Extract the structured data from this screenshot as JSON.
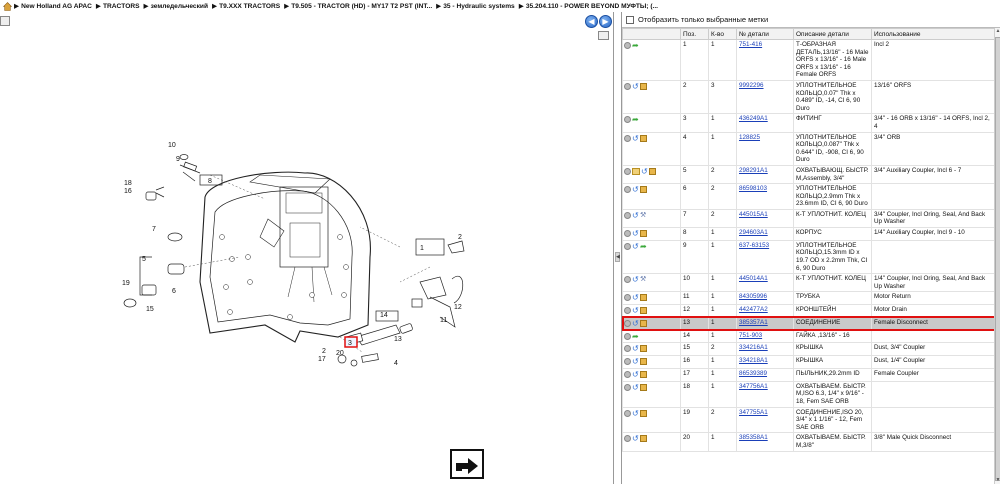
{
  "breadcrumb": [
    "New Holland AG APAC",
    "TRACTORS",
    "земледельческий",
    "T9.XXX TRACTORS",
    "T9.505 - TRACTOR (HD) - MY17 T2 PST (INT...",
    "35 - Hydraulic systems",
    "35.204.110 - POWER BEYOND МУФТЫ; (..."
  ],
  "filter_label": "Отобразить только выбранные метки",
  "columns": [
    "",
    "Поз.",
    "К-во",
    "№ детали",
    "Описание детали",
    "Использование"
  ],
  "diagram_labels": [
    "10",
    "9",
    "8",
    "18",
    "16",
    "7",
    "5",
    "6",
    "19",
    "15",
    "1",
    "2",
    "11",
    "12",
    "14",
    "3",
    "13",
    "2",
    "4",
    "17",
    "20"
  ],
  "rows": [
    {
      "icons": [
        "info",
        "green"
      ],
      "pos": "1",
      "qty": "1",
      "part": "751-416",
      "desc": "Т-ОБРАЗНАЯ ДЕТАЛЬ,13/16\" - 16 Male ORFS x 13/16\" - 16 Male ORFS x 13/16\" - 16 Female ORFS",
      "usage": "Incl 2"
    },
    {
      "icons": [
        "info",
        "blue",
        "box"
      ],
      "pos": "2",
      "qty": "3",
      "part": "9992296",
      "desc": "УПЛОТНИТЕЛЬНОЕ КОЛЬЦО,0.07\" Thk x 0.489\" ID, -14, CI 6, 90 Duro",
      "usage": "13/16\" ORFS"
    },
    {
      "icons": [
        "info",
        "green"
      ],
      "pos": "3",
      "qty": "1",
      "part": "436249A1",
      "desc": "ФИТИНГ",
      "usage": "3/4\" - 16 ORB x 13/16\" - 14 ORFS, Incl 2, 4"
    },
    {
      "icons": [
        "info",
        "blue",
        "box"
      ],
      "pos": "4",
      "qty": "1",
      "part": "128825",
      "desc": "УПЛОТНИТЕЛЬНОЕ КОЛЬЦО,0.087\" Thk x 0.644\" ID, -908, CI 6, 90 Duro",
      "usage": "3/4\" ORB"
    },
    {
      "icons": [
        "info",
        "folder",
        "blue",
        "box"
      ],
      "pos": "5",
      "qty": "2",
      "part": "298291A1",
      "desc": "ОХВАТЫВАЮЩ. БЫСТР. М,Assembly, 3/4\"",
      "usage": "3/4\" Auxiliary Coupler, Incl 6 - 7"
    },
    {
      "icons": [
        "info",
        "blue",
        "box"
      ],
      "pos": "6",
      "qty": "2",
      "part": "86598103",
      "desc": "УПЛОТНИТЕЛЬНОЕ КОЛЬЦО,2.9mm Thk x 23.6mm ID, CI 6, 90 Duro",
      "usage": ""
    },
    {
      "icons": [
        "info",
        "blue",
        "wrench"
      ],
      "pos": "7",
      "qty": "2",
      "part": "445015A1",
      "desc": "К-Т УПЛОТНИТ. КОЛЕЦ",
      "usage": "3/4\" Coupler, Incl Oring, Seal, And Back Up Washer"
    },
    {
      "icons": [
        "info",
        "blue",
        "box"
      ],
      "pos": "8",
      "qty": "1",
      "part": "294603A1",
      "desc": "КОРПУС",
      "usage": "1/4\" Auxiliary Coupler, Incl 9 - 10"
    },
    {
      "icons": [
        "info",
        "blue",
        "green"
      ],
      "pos": "9",
      "qty": "1",
      "part": "637-63153",
      "desc": "УПЛОТНИТЕЛЬНОЕ КОЛЬЦО,15.3mm ID x 19.7 OD x 2.2mm Thk, CI 6, 90 Duro",
      "usage": ""
    },
    {
      "icons": [
        "info",
        "blue",
        "wrench"
      ],
      "pos": "10",
      "qty": "1",
      "part": "445014A1",
      "desc": "К-Т УПЛОТНИТ. КОЛЕЦ",
      "usage": "1/4\" Coupler, Incl Oring, Seal, And Back Up Washer"
    },
    {
      "icons": [
        "info",
        "blue",
        "box"
      ],
      "pos": "11",
      "qty": "1",
      "part": "84305996",
      "desc": "ТРУБКА",
      "usage": "Motor Return"
    },
    {
      "icons": [
        "info",
        "blue",
        "box"
      ],
      "pos": "12",
      "qty": "1",
      "part": "442477A2",
      "desc": "КРОНШТЕЙН",
      "usage": "Motor Drain"
    },
    {
      "icons": [
        "info",
        "blue",
        "box"
      ],
      "pos": "13",
      "qty": "1",
      "part": "385357A1",
      "desc": "СОЕДИНЕНИЕ",
      "usage": "Female Disconnect",
      "selected": true
    },
    {
      "icons": [
        "info",
        "green"
      ],
      "pos": "14",
      "qty": "1",
      "part": "751-903",
      "desc": "ГАЙКА ,13/16\" - 16",
      "usage": ""
    },
    {
      "icons": [
        "info",
        "blue",
        "box"
      ],
      "pos": "15",
      "qty": "2",
      "part": "334216A1",
      "desc": "КРЫШКА",
      "usage": "Dust, 3/4\" Coupler"
    },
    {
      "icons": [
        "info",
        "blue",
        "box"
      ],
      "pos": "16",
      "qty": "1",
      "part": "334218A1",
      "desc": "КРЫШКА",
      "usage": "Dust, 1/4\" Coupler"
    },
    {
      "icons": [
        "info",
        "blue",
        "box"
      ],
      "pos": "17",
      "qty": "1",
      "part": "86539389",
      "desc": "ПЫЛЬНИК,29.2mm ID",
      "usage": "Female Coupler"
    },
    {
      "icons": [
        "info",
        "blue",
        "box"
      ],
      "pos": "18",
      "qty": "1",
      "part": "347756A1",
      "desc": "ОХВАТЫВАЕМ. БЫСТР. М,ISO 6.3, 1/4\" x 9/16\" - 18, Fem SAE ORB",
      "usage": ""
    },
    {
      "icons": [
        "info",
        "blue",
        "box"
      ],
      "pos": "19",
      "qty": "2",
      "part": "347755A1",
      "desc": "СОЕДИНЕНИЕ,ISO 20, 3/4\" x 1 1/16\" - 12, Fem SAE ORB",
      "usage": ""
    },
    {
      "icons": [
        "info",
        "blue",
        "box"
      ],
      "pos": "20",
      "qty": "1",
      "part": "385358A1",
      "desc": "ОХВАТЫВАЕМ. БЫСТР. М,3/8\"",
      "usage": "3/8\" Male Quick Disconnect"
    }
  ]
}
